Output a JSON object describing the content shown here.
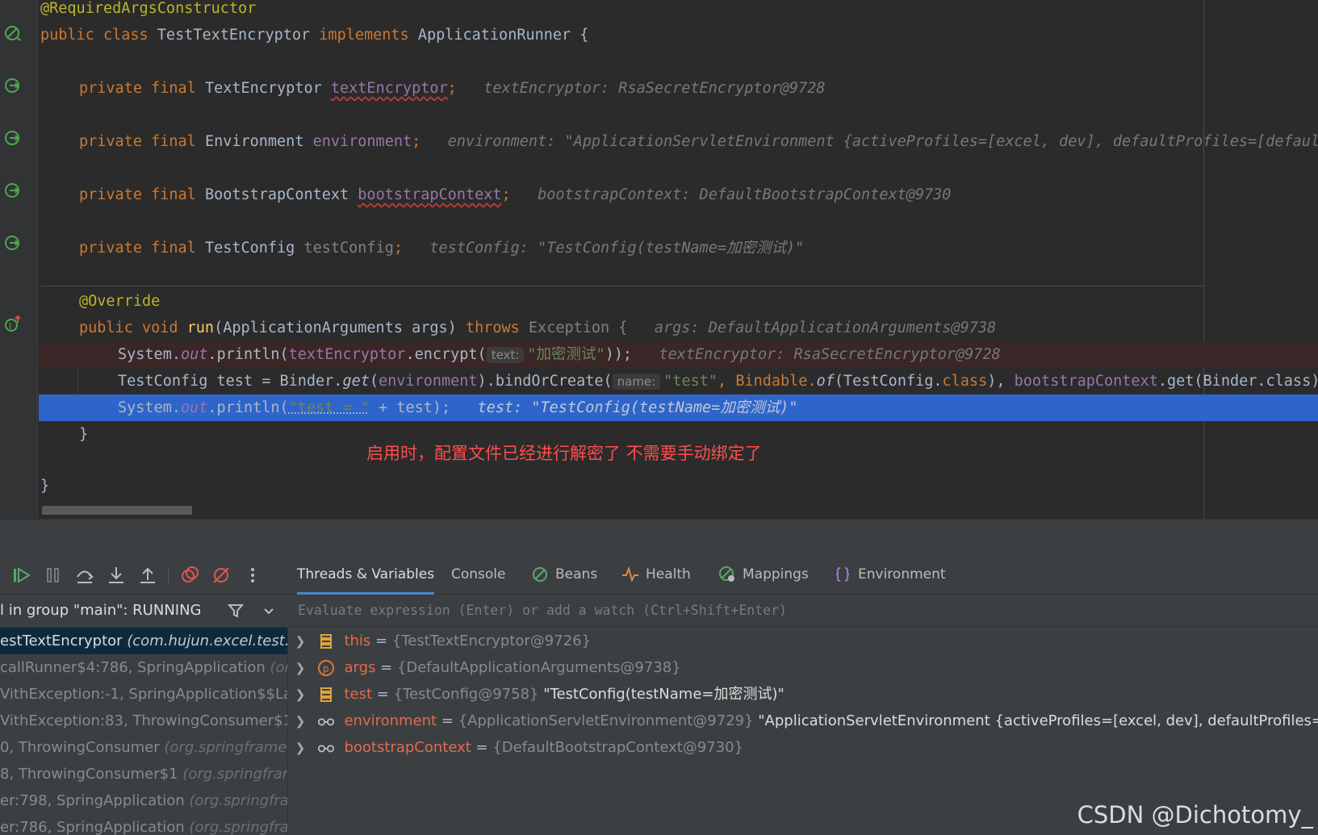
{
  "code": {
    "lines": [
      {
        "annotation": "@RequiredArgsConstructor"
      },
      {
        "kw1": "public class ",
        "name": "TestTextEncryptor",
        "kw2": " implements ",
        "iface": "ApplicationRunner {"
      },
      {
        "kw": "private final ",
        "type": "TextEncryptor ",
        "field": "textEncryptor",
        "semi": ";",
        "inline": "textEncryptor: RsaSecretEncryptor@9728"
      },
      {
        "kw": "private final ",
        "type": "Environment ",
        "field": "environment",
        "semi": ";",
        "inline": "environment: \"ApplicationServletEnvironment {activeProfiles=[excel, dev], defaultProfiles=[default], propertySources=[...]}\""
      },
      {
        "kw": "private final ",
        "type": "BootstrapContext ",
        "field": "bootstrapContext",
        "semi": ";",
        "inline": "bootstrapContext: DefaultBootstrapContext@9730"
      },
      {
        "kw": "private final ",
        "type": "TestConfig ",
        "field": "testConfig",
        "semi": ";",
        "inline": "testConfig: \"TestConfig(testName=加密测试)\""
      },
      {
        "annotation": "@Override"
      },
      {
        "kw1": "public void ",
        "method": "run",
        "params": "(ApplicationArguments args) ",
        "kw2": "throws ",
        "exc": "Exception {",
        "inline": "args: DefaultApplicationArguments@9738"
      },
      {
        "pre": "System.",
        "out": "out",
        "mid": ".println(",
        "field": "textEncryptor",
        "call": ".encrypt(",
        "hint": "text:",
        "str": "\"加密测试\"",
        "post": "));",
        "inline": "textEncryptor: RsaSecretEncryptor@9728"
      },
      {
        "pre": "TestConfig test = Binder.",
        "get": "get",
        "mid": "(",
        "field": "environment",
        "call": ").bindOrCreate(",
        "hint": "name:",
        "str": "\"test\"",
        "post1": ", Bindable.",
        "of": "of",
        "post2": "(TestConfig.",
        "cls": "class",
        "post3": "), ",
        "field2": "bootstrapContext",
        "post4": ".get(Binder.class));"
      },
      {
        "pre": "System.",
        "out": "out",
        "mid": ".println(",
        "str": "\"test = \"",
        "post": " + test);",
        "inline": "test: \"TestConfig(testName=加密测试)\""
      },
      {
        "text": "}"
      },
      {
        "text": "}"
      }
    ],
    "note": "启用时，配置文件已经进行解密了 不需要手动绑定了"
  },
  "debugger": {
    "tabs": [
      "Threads & Variables",
      "Console",
      "Beans",
      "Health",
      "Mappings",
      "Environment"
    ],
    "thread_label": "l in group \"main\": RUNNING",
    "eval_placeholder": "Evaluate expression (Enter) or add a watch (Ctrl+Shift+Enter)",
    "frames": [
      {
        "name": "estTextEncryptor ",
        "pkg": "(com.hujun.excel.test.co"
      },
      {
        "name": "callRunner$4:786, SpringApplication ",
        "pkg": "(org"
      },
      {
        "name": "VithException:-1, SpringApplication$$Lam",
        "pkg": ""
      },
      {
        "name": "VithException:83, ThrowingConsumer$1 ",
        "pkg": "(o"
      },
      {
        "name": "0, ThrowingConsumer ",
        "pkg": "(org.springframew"
      },
      {
        "name": "8, ThrowingConsumer$1 ",
        "pkg": "(org.springfram"
      },
      {
        "name": "er:798, SpringApplication ",
        "pkg": "(org.springfran"
      },
      {
        "name": "er:786, SpringApplication ",
        "pkg": "(org.springfran"
      }
    ],
    "variables": [
      {
        "name": "this",
        "type": "{TestTextEncryptor@9726}",
        "value": "",
        "icon": "field-icon"
      },
      {
        "name": "args",
        "type": "{DefaultApplicationArguments@9738}",
        "value": "",
        "icon": "parameter-icon"
      },
      {
        "name": "test",
        "type": "{TestConfig@9758}",
        "value": "\"TestConfig(testName=加密测试)\"",
        "icon": "field-icon"
      },
      {
        "name": "environment",
        "type": "{ApplicationServletEnvironment@9729}",
        "value": "\"ApplicationServletEnvironment {activeProfiles=[excel, dev], defaultProfiles=[default],",
        "icon": "glasses-icon"
      },
      {
        "name": "bootstrapContext",
        "type": "{DefaultBootstrapContext@9730}",
        "value": "",
        "icon": "glasses-icon"
      }
    ]
  },
  "watermark": "CSDN @Dichotomy_"
}
